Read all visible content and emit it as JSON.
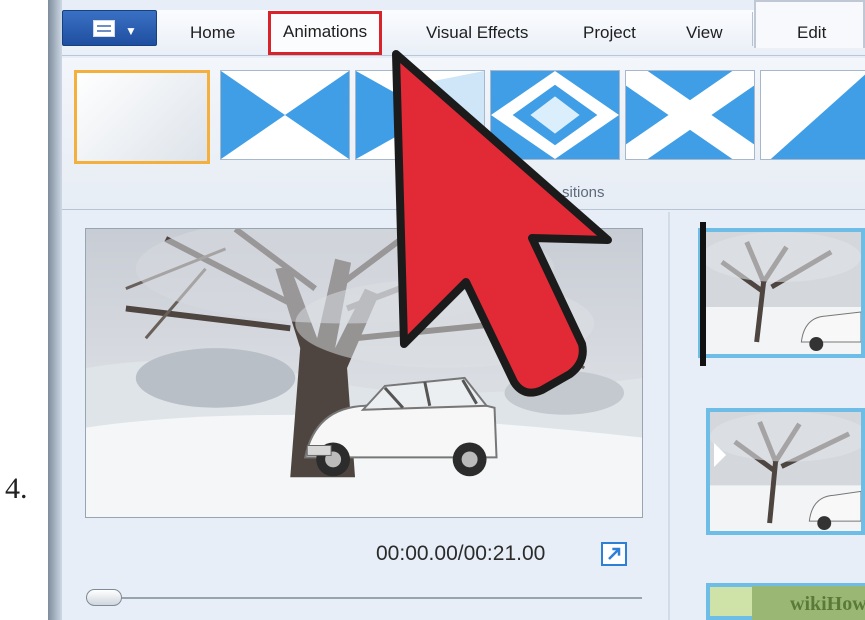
{
  "step": {
    "number": "4."
  },
  "ribbon": {
    "tabs": [
      {
        "label": "Home"
      },
      {
        "label": "Animations",
        "active": true
      },
      {
        "label": "Visual Effects"
      },
      {
        "label": "Project"
      },
      {
        "label": "View"
      },
      {
        "label": "Edit"
      }
    ],
    "file_menu_icon": "document-icon",
    "group_label": "sitions",
    "transitions": [
      {
        "name": "none",
        "selected": true
      },
      {
        "name": "diagonal-cross-wipe"
      },
      {
        "name": "horizontal-wedge-wipe"
      },
      {
        "name": "diamond-wipe"
      },
      {
        "name": "cross-wipe"
      },
      {
        "name": "diagonal-wipe"
      }
    ]
  },
  "preview": {
    "timecode": "00:00.00/00:21.00",
    "fullscreen_icon": "expand-arrow-icon",
    "seek_progress": 0
  },
  "storyboard": {
    "clips": [
      {
        "name": "clip-1"
      },
      {
        "name": "clip-2"
      },
      {
        "name": "clip-3"
      }
    ]
  },
  "watermark": {
    "text": "wikiHow"
  },
  "annotation": {
    "pointer": "red-arrow-icon"
  },
  "colors": {
    "highlight": "#d8232a",
    "selection": "#f4b03e",
    "accent": "#6dbde6",
    "file_button": "#2a5db0"
  }
}
